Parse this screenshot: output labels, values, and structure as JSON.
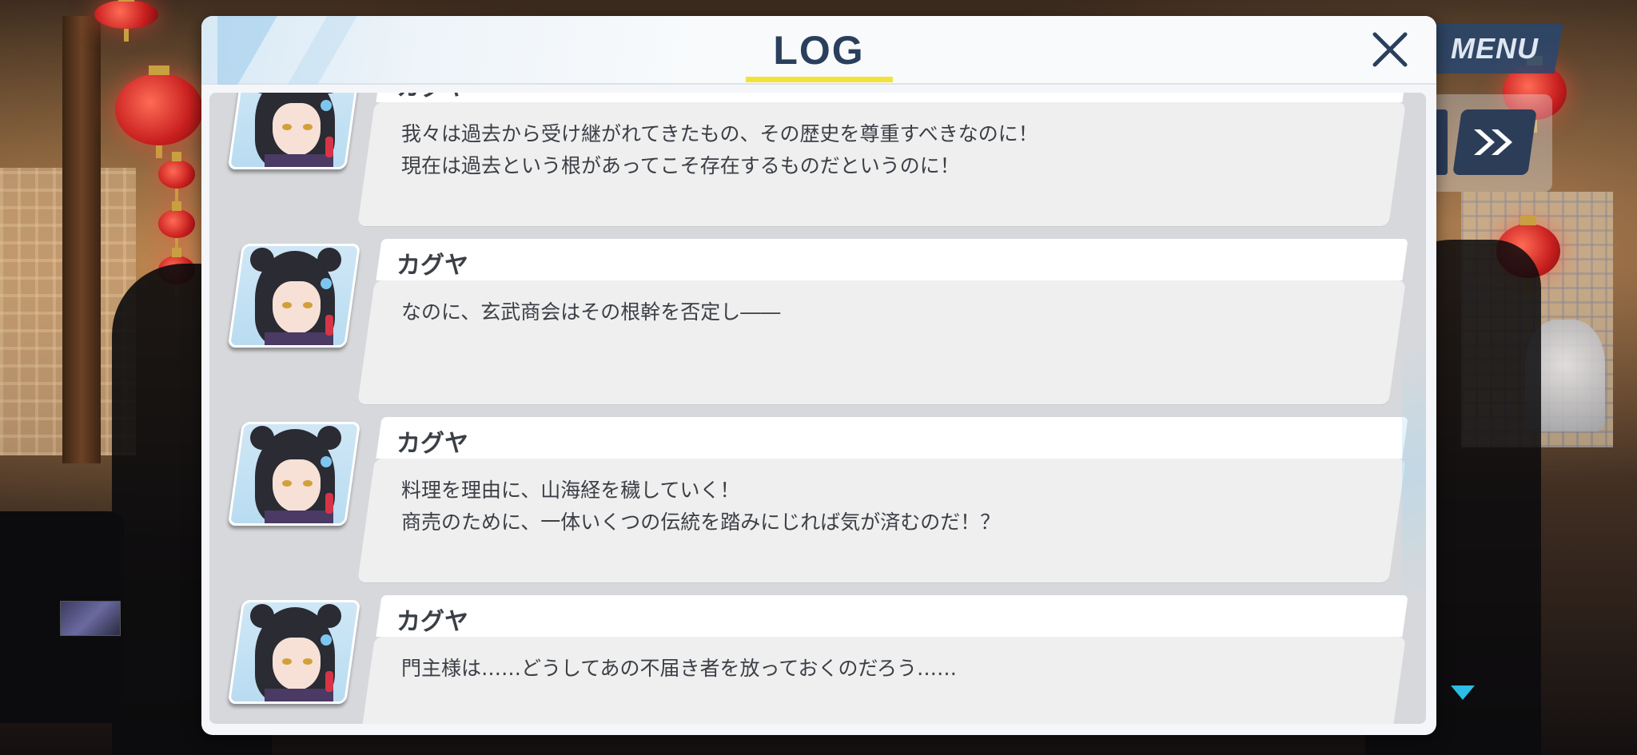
{
  "log": {
    "title": "LOG",
    "entries": [
      {
        "speaker": "カグヤ",
        "text": "我々は過去から受け継がれてきたもの、その歴史を尊重すべきなのに！\n現在は過去という根があってこそ存在するものだというのに！"
      },
      {
        "speaker": "カグヤ",
        "text": "なのに、玄武商会はその根幹を否定し――"
      },
      {
        "speaker": "カグヤ",
        "text": "料理を理由に、山海経を穢していく！\n商売のために、一体いくつの伝統を踏みにじれば気が済むのだ！？"
      },
      {
        "speaker": "カグヤ",
        "text": "門主様は……どうしてあの不届き者を放っておくのだろう……"
      }
    ]
  },
  "hud": {
    "menu_label": "MENU"
  },
  "icons": {
    "close": "close-icon",
    "fast_forward": "fast-forward-icon",
    "scroll_down": "triangle-down-icon"
  },
  "colors": {
    "title": "#2a3f5c",
    "title_underline": "#f2e23a",
    "menu_bg": "#284670",
    "fast_forward_bg": "#2c3d58",
    "scroll_indicator": "#2bbde6"
  }
}
